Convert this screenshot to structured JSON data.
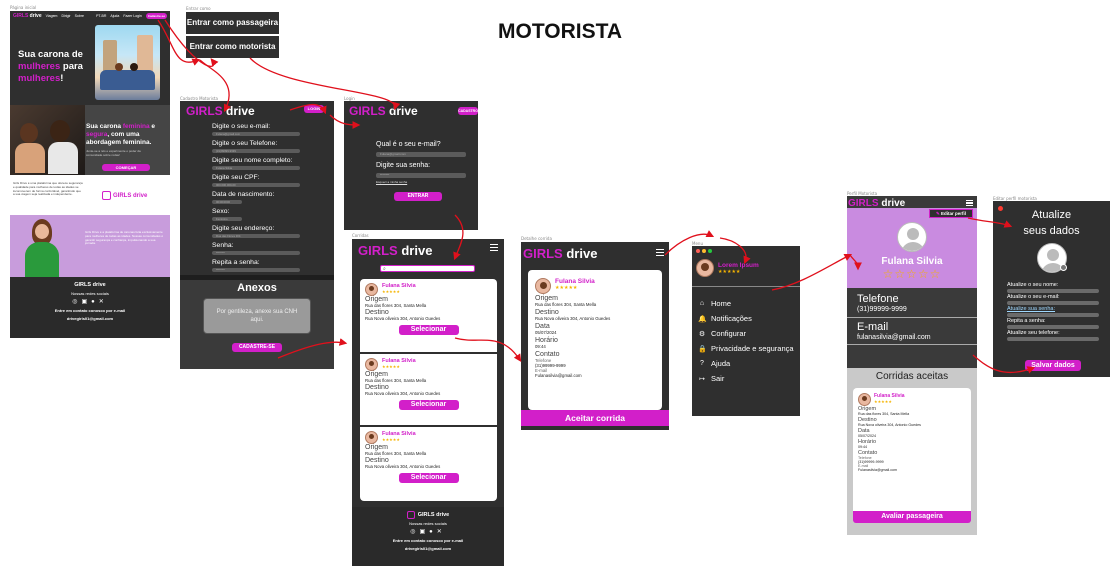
{
  "page_title": "MOTORISTA",
  "captions": {
    "landing": "Página inicial",
    "entrar": "Entrar como",
    "cadastro": "Cadastro Motorista",
    "login": "Login",
    "lista": "Corridas",
    "detalhe": "Detalhe corrida",
    "menu": "Menu",
    "perfil": "Perfil Motorista",
    "editar": "Editar perfil motorista"
  },
  "brand": {
    "girls": "GIRLS",
    "drive": " drive",
    "accent": "#d21fc9"
  },
  "landing": {
    "nav": [
      "Viagem",
      "Dirigir",
      "Sobre"
    ],
    "nav_right": [
      "PT-BR",
      "Ajuda",
      "Fazer Login"
    ],
    "nav_cta": "Cadastre-se",
    "hero_1": "Sua carona de",
    "hero_2": "mulheres",
    "hero_3": " para",
    "hero_4": "mulheres",
    "hero_5": "!",
    "sec2_a": "Sua carona ",
    "sec2_b": "feminina",
    "sec2_c": " e ",
    "sec2_d": "segura",
    "sec2_e": ", com uma abordagem feminina.",
    "sec2_small": "Junte-se a nós e experimente o poder da comunidade sobre rodas!",
    "sec2_btn": "COMEÇAR",
    "sec3_text": "Girls Drive é uma plataforma que oferece segurança e qualidade para mulheres de todas as idades se locomoverem de forma confortável, garantindo que a sua viagem seja realizada e independente.",
    "sec3_logo": "GIRLS drive",
    "sec4_text": "Girls Drive é a plataforma de caronas feita exclusivamente para mulheres de todas as idades. Nossas comunidades é garantir segurança e confiança, impulsionando a sua jornada.",
    "footer_title": "GIRLS drive",
    "footer_social": "Nossas redes sociais",
    "footer_contact": "Entre em contato conosco por e-mail",
    "footer_email": "drivegirls01@gmail.com"
  },
  "entrar": {
    "passageira": "Entrar como passageira",
    "motorista": "Entrar como motorista"
  },
  "cadastro": {
    "badge": "LOGIN",
    "fields": [
      "Digite o seu e-mail:",
      "Digite o seu Telefone:",
      "Digite seu nome completo:",
      "Digite seu CPF:",
      "Data de nascimento:",
      "Sexo:",
      "Digite seu endereço:",
      "Senha:",
      "Repita a senha:"
    ],
    "placeholders": [
      "Fulana@gmail.com",
      "(31)99999-9999",
      "Fulana Silvia",
      "000.000.000-00",
      "00/00/0000",
      "Feminino",
      "Rua das Flores 304",
      "********",
      "********"
    ],
    "anexos": "Anexos",
    "anexos_box": "Por gentileza, anexe sua CNH aqui.",
    "button": "CADASTRE-SE"
  },
  "login": {
    "badge": "CADASTRO",
    "email_label": "Qual é o seu e-mail?",
    "email_ph": "Fulana@gmail.com",
    "pass_label": "Digite sua senha:",
    "pass_ph": "********",
    "forgot": "Esqueci a minha senha",
    "button": "ENTRAR"
  },
  "lista": {
    "rides": [
      {
        "name": "Fulana Silvia",
        "stars": "★★★★★",
        "origem_l": "Origem",
        "origem": "Rua das flores 304, Santa Mella",
        "destino_l": "Destino",
        "destino": "Rua Nova oliveira 304, Antonio Guedes",
        "btn": "Selecionar"
      },
      {
        "name": "Fulana Silvia",
        "stars": "★★★★★",
        "origem_l": "Origem",
        "origem": "Rua das flores 304, Santa Mella",
        "destino_l": "Destino",
        "destino": "Rua Nova oliveira 304, Antonio Guedes",
        "btn": "Selecionar"
      },
      {
        "name": "Fulana Silvia",
        "stars": "★★★★★",
        "origem_l": "Origem",
        "origem": "Rua das flores 304, Santa Mella",
        "destino_l": "Destino",
        "destino": "Rua Nova oliveira 304, Antonio Guedes",
        "btn": "Selecionar"
      }
    ],
    "footer_title": "GIRLS drive",
    "footer_social": "Nossas redes sociais",
    "footer_contact": "Entre em contato conosco por e-mail",
    "footer_email": "drivegirls01@gmail.com"
  },
  "detalhe": {
    "name": "Fulana Silvia",
    "stars": "★★★★★",
    "origem_l": "Origem",
    "origem": "Rua das flores 304, Santa Mella",
    "destino_l": "Destino",
    "destino": "Rua Nova oliveira 304, Antonio Guedes",
    "data_l": "Data",
    "data": "05/07/2024",
    "hora_l": "Horário",
    "hora": "09:44",
    "contato_l": "Contato",
    "tel_l": "Telefone",
    "tel": "(31)99999-9999",
    "mail_l": "E-mail",
    "mail": "Fulanasilvia@gmail.com",
    "button": "Aceitar corrida"
  },
  "menu": {
    "user": "Lorem Ipsum",
    "stars": "★★★★★",
    "items": [
      "Home",
      "Notificações",
      "Configurar",
      "Privacidade e segurança",
      "Ajuda",
      "Sair"
    ]
  },
  "perfil": {
    "edit": "Editar perfil",
    "name": "Fulana Silvia",
    "stars": "☆☆☆☆☆",
    "tel_l": "Telefone",
    "tel": "(31)99999-9999",
    "mail_l": "E-mail",
    "mail": "fulanasilvia@gmail.com",
    "aceitas": "Corridas aceitas",
    "card": {
      "name": "Fulana Silvia",
      "stars": "★★★★★",
      "origem_l": "Origem",
      "origem": "Rua das flores 304, Santa Mella",
      "destino_l": "Destino",
      "destino": "Rua Nova oliveira 304, Antonio Guedes",
      "data_l": "Data",
      "data": "05/07/2024",
      "hora_l": "Horário",
      "hora": "09:44",
      "contato_l": "Contato",
      "tel_l": "Telefone",
      "tel": "(31)99999-9999",
      "mail_l": "E-mail",
      "mail": "Fulanasilvia@gmail.com"
    },
    "button": "Avaliar passageira"
  },
  "editar": {
    "title_1": "Atualize",
    "title_2": "seus dados",
    "fields": [
      "Atualize o seu nome:",
      "Atualize o seu e-mail:",
      "Atualize sua senha:",
      "Repita a senha:",
      "Atualize seu telefone:"
    ],
    "button": "Salvar dados"
  }
}
